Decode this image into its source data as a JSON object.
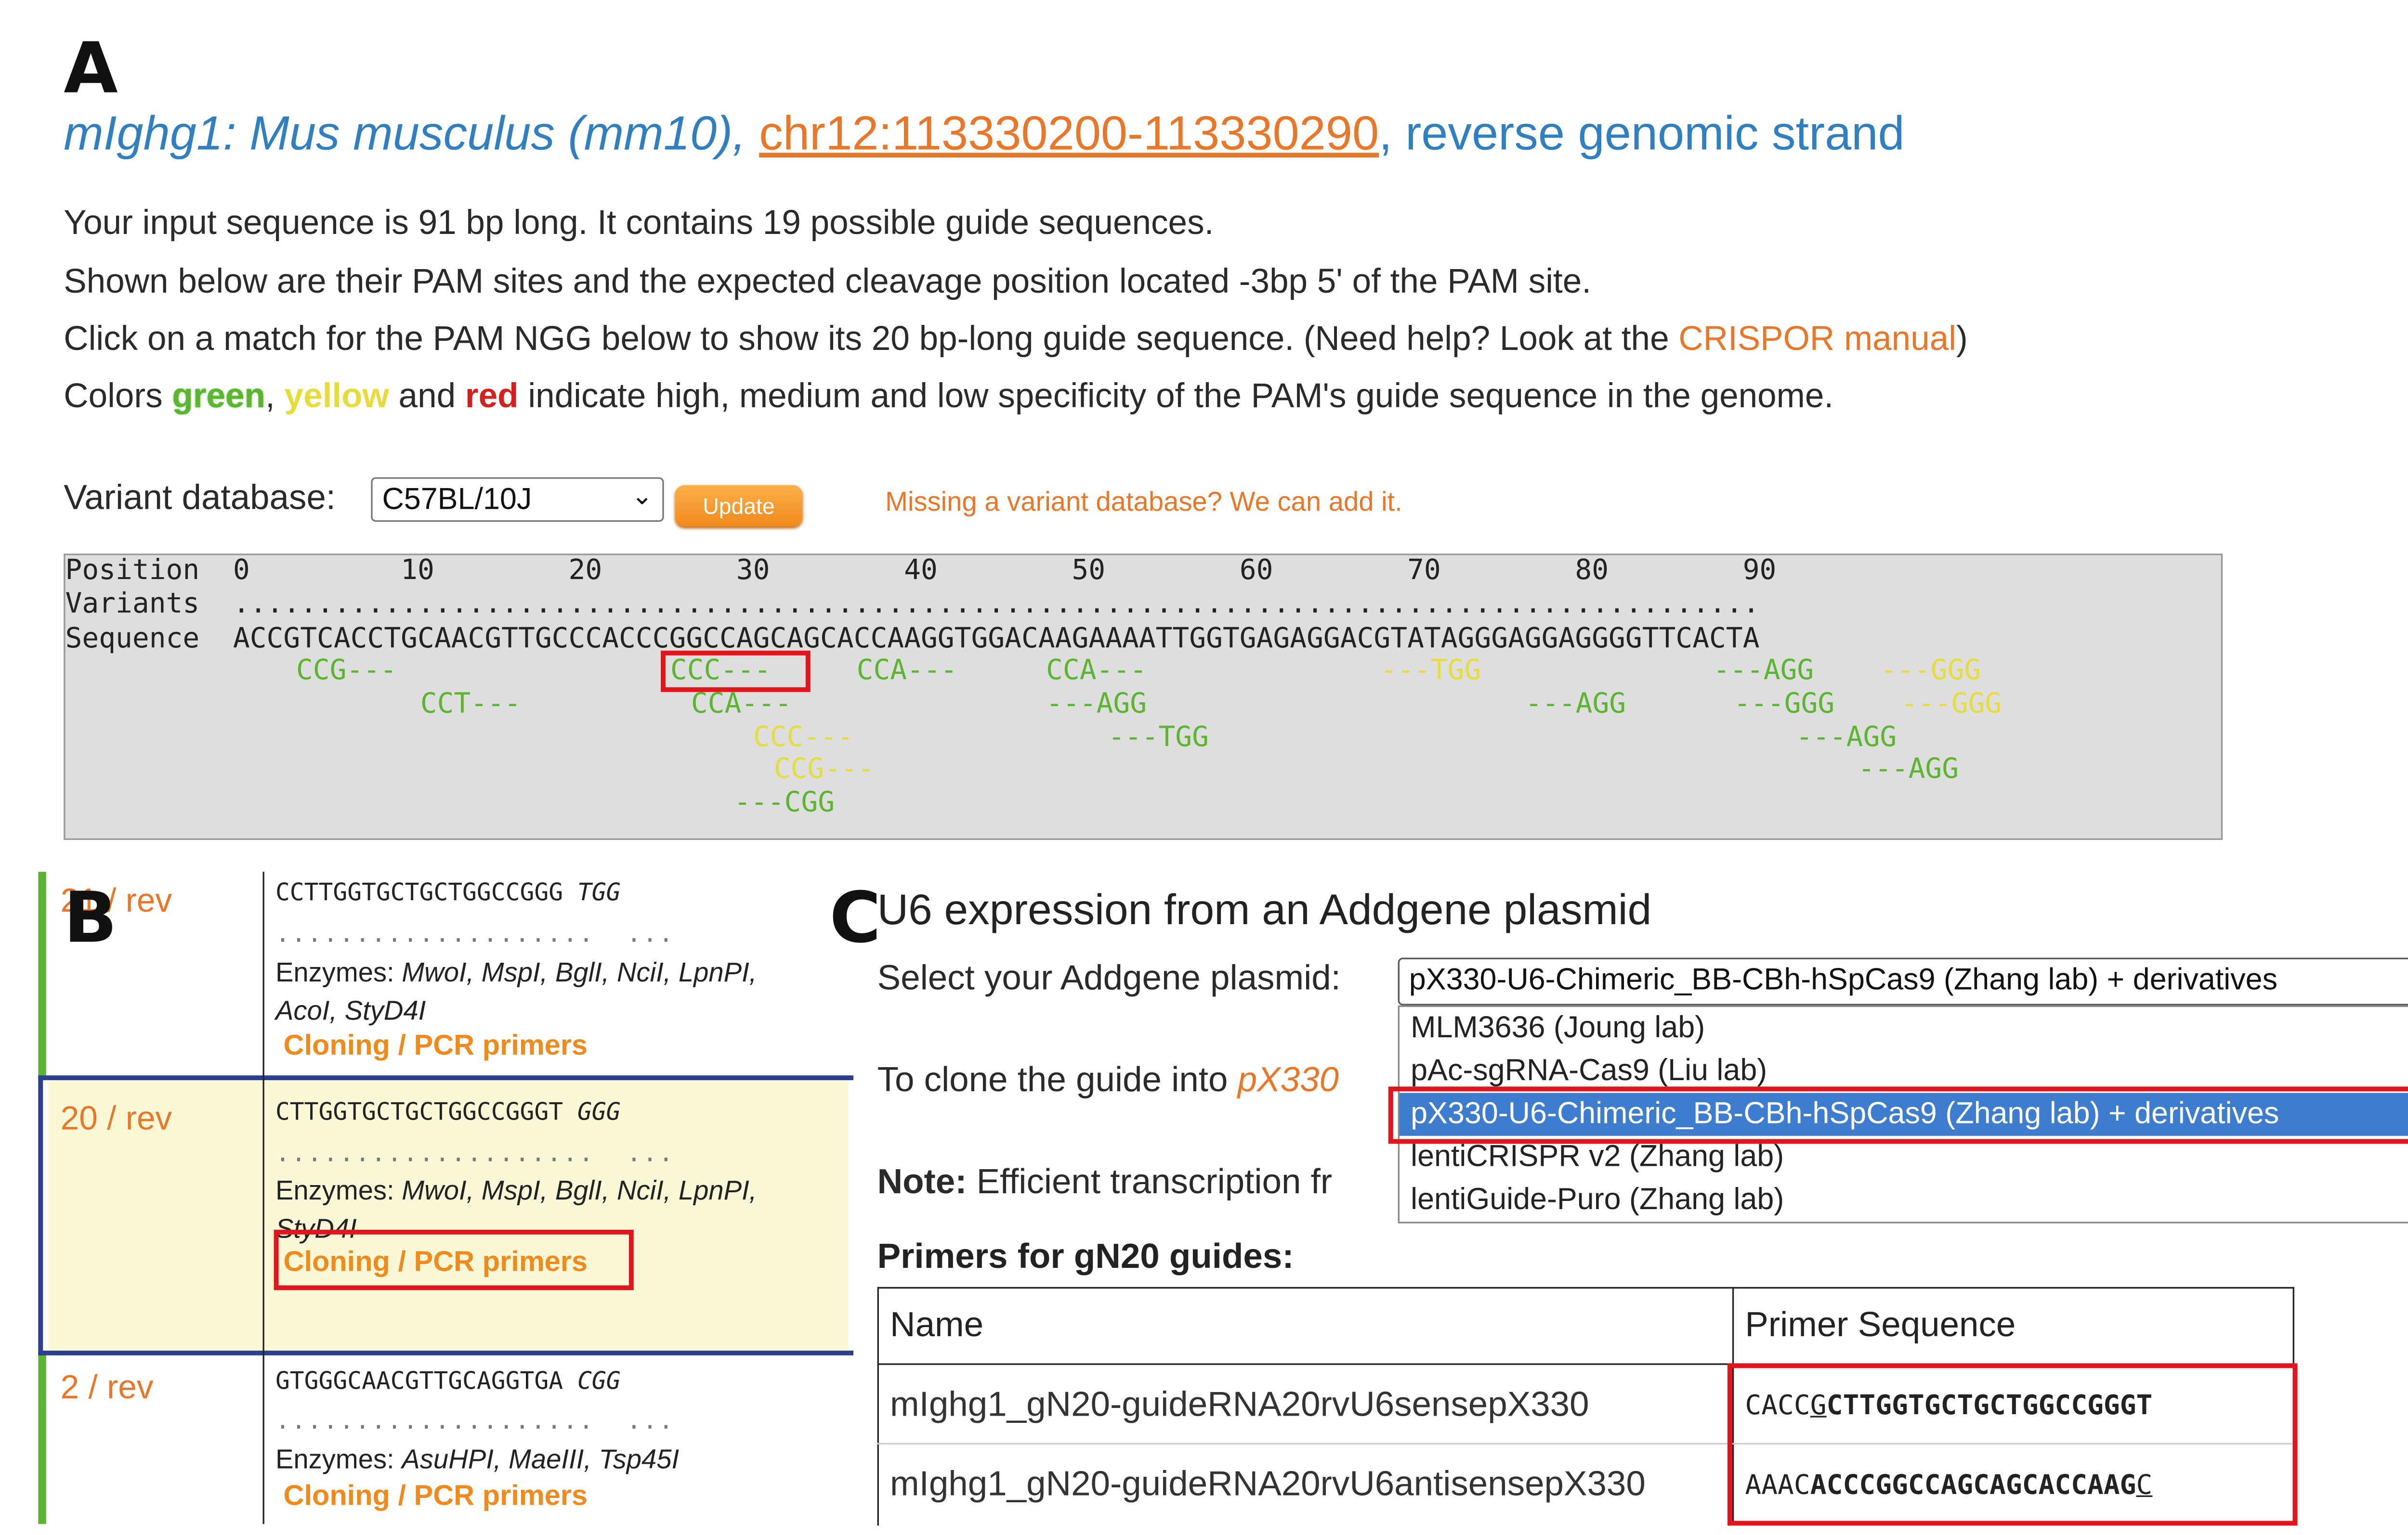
{
  "panel_letters": {
    "a": "A",
    "b": "B",
    "c": "C"
  },
  "header": {
    "gene_species": "mIghg1: Mus musculus (mm10),",
    "locus_link": "chr12:113330200-113330290",
    "strand": ", reverse genomic strand"
  },
  "intro": {
    "line1": "Your input sequence is 91 bp long. It contains 19 possible guide sequences.",
    "line2": "Shown below are their PAM sites and the expected cleavage position located -3bp 5' of the PAM site.",
    "line3_pre": "Click on a match for the PAM NGG below to show its 20 bp-long guide sequence. (Need help? Look at the ",
    "line3_link": "CRISPOR manual",
    "line3_post": ")",
    "line4_pre": "Colors ",
    "green": "green",
    "sep1": ", ",
    "yellow": "yellow",
    "sep2": " and ",
    "red": "red",
    "line4_post": " indicate high, medium and low specificity of the PAM's guide sequence in the genome."
  },
  "variant": {
    "label": "Variant database:",
    "selected": "C57BL/10J",
    "update_label": "Update",
    "missing_text": "Missing a variant database? We can add it."
  },
  "sequence_viewer": {
    "row_position": "Position  0         10        20        30        40        50        60        70        80        90",
    "row_variants": "Variants  ...........................................................................................",
    "row_sequence": "Sequence  ACCGTCACCTGCAACGTTGCCCACCCGGCCAGCAGCACCAAGGTGGACAAGAAAATTGGTGAGAGGACGTATAGGGAGGAGGGGTTCACTA",
    "pams": [
      {
        "text": "CCG---",
        "color": "green"
      },
      {
        "text": "CCT---",
        "color": "green"
      },
      {
        "text": "CCC---",
        "color": "green"
      },
      {
        "text": "CCA---",
        "color": "green"
      },
      {
        "text": "CCC---",
        "color": "yellow"
      },
      {
        "text": "CCG---",
        "color": "yellow"
      },
      {
        "text": "---CGG",
        "color": "green"
      },
      {
        "text": "CCA---",
        "color": "green"
      },
      {
        "text": "CCA---",
        "color": "green"
      },
      {
        "text": "---AGG",
        "color": "green"
      },
      {
        "text": "---TGG",
        "color": "green"
      },
      {
        "text": "---TGG",
        "color": "yellow"
      },
      {
        "text": "---AGG",
        "color": "green"
      },
      {
        "text": "---AGG",
        "color": "green"
      },
      {
        "text": "---GGG",
        "color": "green"
      },
      {
        "text": "---AGG",
        "color": "green"
      },
      {
        "text": "---AGG",
        "color": "green"
      },
      {
        "text": "---GGG",
        "color": "yellow"
      },
      {
        "text": "---GGG",
        "color": "yellow"
      }
    ]
  },
  "guides": [
    {
      "position": "21 / rev",
      "sequence": "CCTTGGTGCTGCTGGCCGGG",
      "pam": "TGG",
      "dots": "....................  ...",
      "enzymes_label": "Enzymes: ",
      "enzymes": "MwoI, MspI, BglI, NciI, LpnPI, AcoI, StyD4I",
      "cloning": "Cloning / PCR primers"
    },
    {
      "position": "20 / rev",
      "sequence": "CTTGGTGCTGCTGGCCGGGT",
      "pam": "GGG",
      "dots": "....................  ...",
      "enzymes_label": "Enzymes: ",
      "enzymes": "MwoI, MspI, BglI, NciI, LpnPI, StyD4I",
      "cloning": "Cloning / PCR primers"
    },
    {
      "position": "2 / rev",
      "sequence": "GTGGGCAACGTTGCAGGTGA",
      "pam": "CGG",
      "dots": "....................  ...",
      "enzymes_label": "Enzymes: ",
      "enzymes": "AsuHPI, MaeIII, Tsp45I",
      "cloning": "Cloning / PCR primers"
    }
  ],
  "panel_c": {
    "title": "U6 expression from an Addgene plasmid",
    "select_label": "Select your Addgene plasmid:",
    "selected": "pX330-U6-Chimeric_BB-CBh-hSpCas9 (Zhang lab) + derivatives",
    "options": [
      "MLM3636 (Joung lab)",
      "pAc-sgRNA-Cas9 (Liu lab)",
      "pX330-U6-Chimeric_BB-CBh-hSpCas9 (Zhang lab) + derivatives",
      "lentiCRISPR v2 (Zhang lab)",
      "lentiGuide-Puro (Zhang lab)"
    ],
    "clone_pre": "To clone the guide into ",
    "clone_plasmid": "pX330",
    "note_label": "Note:",
    "note_text": " Efficient transcription fr",
    "primers_title": "Primers for gN20 guides:",
    "table_headers": [
      "Name",
      "Primer Sequence"
    ],
    "rows": [
      {
        "name": "mIghg1_gN20-guideRNA20rvU6sensepX330",
        "seq_prefix": "CACC",
        "seq_under": "G",
        "seq_bold": "CTTGGTGCTGCTGGCCGGGT",
        "seq_suffix": ""
      },
      {
        "name": "mIghg1_gN20-guideRNA20rvU6antisensepX330",
        "seq_prefix": "AAAC",
        "seq_under": "",
        "seq_bold": "ACCCGGCCAGCAGCACCAAG",
        "seq_suffix": "C"
      }
    ]
  }
}
